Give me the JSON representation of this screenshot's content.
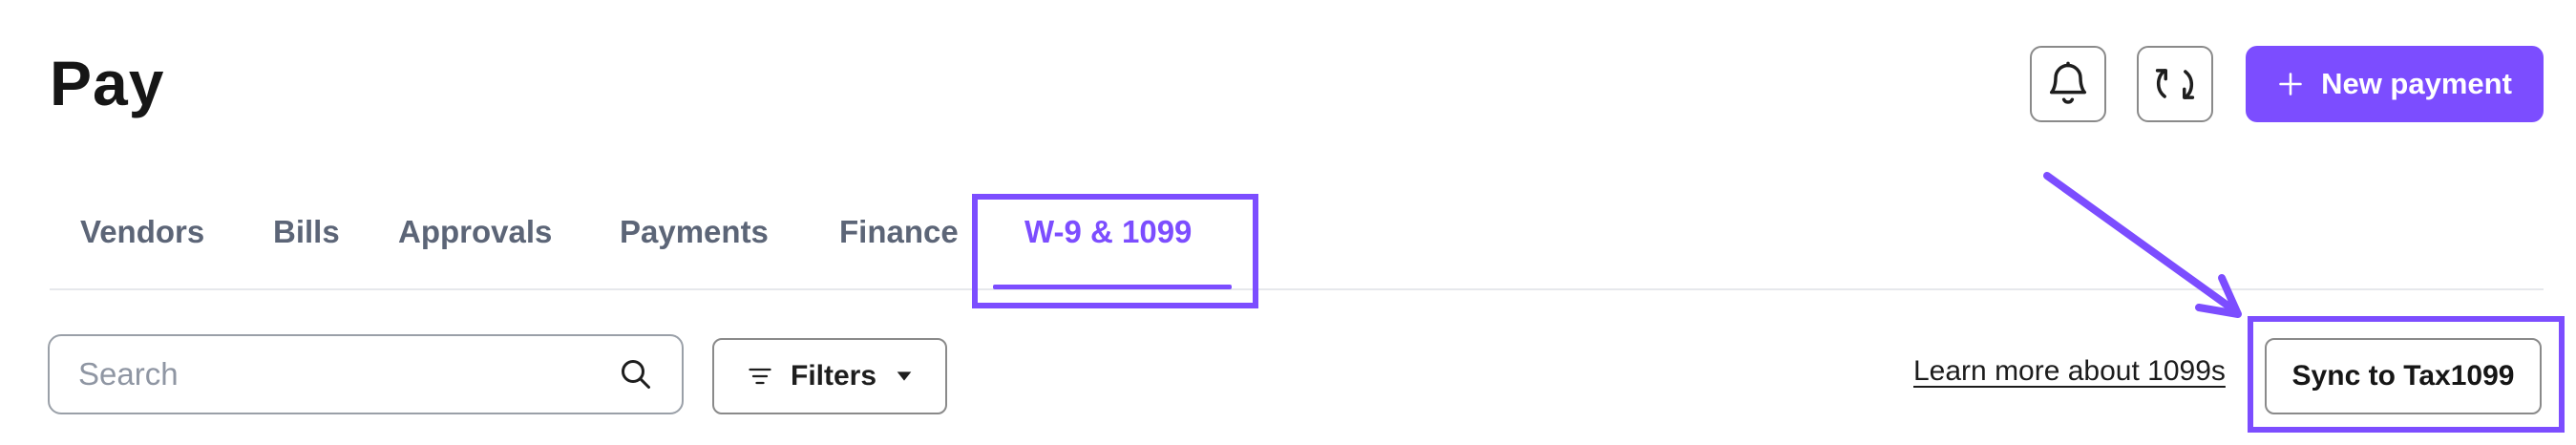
{
  "header": {
    "title": "Pay",
    "new_payment_label": "New payment",
    "icons": {
      "bell": "bell-icon",
      "sync": "sync-icon",
      "plus": "plus-icon"
    }
  },
  "tabs": [
    {
      "label": "Vendors",
      "active": false
    },
    {
      "label": "Bills",
      "active": false
    },
    {
      "label": "Approvals",
      "active": false
    },
    {
      "label": "Payments",
      "active": false
    },
    {
      "label": "Finance",
      "active": false
    },
    {
      "label": "W-9 & 1099",
      "active": true
    }
  ],
  "toolbar": {
    "search_placeholder": "Search",
    "filters_label": "Filters",
    "learn_more_link": "Learn more about 1099s",
    "sync_label": "Sync to Tax1099"
  },
  "colors": {
    "accent": "#7c4dff",
    "tab_inactive": "#5c6577",
    "border": "#8a8a8a"
  }
}
